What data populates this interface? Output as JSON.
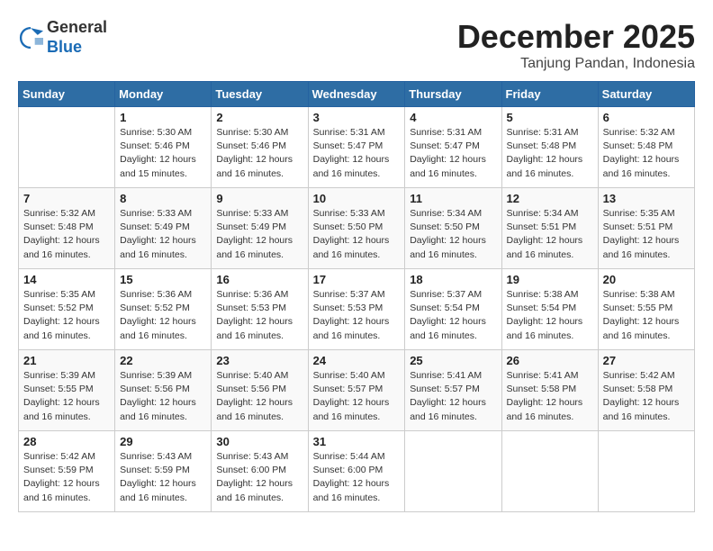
{
  "logo": {
    "general": "General",
    "blue": "Blue"
  },
  "title": "December 2025",
  "location": "Tanjung Pandan, Indonesia",
  "days_of_week": [
    "Sunday",
    "Monday",
    "Tuesday",
    "Wednesday",
    "Thursday",
    "Friday",
    "Saturday"
  ],
  "weeks": [
    [
      {
        "day": "",
        "info": ""
      },
      {
        "day": "1",
        "info": "Sunrise: 5:30 AM\nSunset: 5:46 PM\nDaylight: 12 hours\nand 15 minutes."
      },
      {
        "day": "2",
        "info": "Sunrise: 5:30 AM\nSunset: 5:46 PM\nDaylight: 12 hours\nand 16 minutes."
      },
      {
        "day": "3",
        "info": "Sunrise: 5:31 AM\nSunset: 5:47 PM\nDaylight: 12 hours\nand 16 minutes."
      },
      {
        "day": "4",
        "info": "Sunrise: 5:31 AM\nSunset: 5:47 PM\nDaylight: 12 hours\nand 16 minutes."
      },
      {
        "day": "5",
        "info": "Sunrise: 5:31 AM\nSunset: 5:48 PM\nDaylight: 12 hours\nand 16 minutes."
      },
      {
        "day": "6",
        "info": "Sunrise: 5:32 AM\nSunset: 5:48 PM\nDaylight: 12 hours\nand 16 minutes."
      }
    ],
    [
      {
        "day": "7",
        "info": "Sunrise: 5:32 AM\nSunset: 5:48 PM\nDaylight: 12 hours\nand 16 minutes."
      },
      {
        "day": "8",
        "info": "Sunrise: 5:33 AM\nSunset: 5:49 PM\nDaylight: 12 hours\nand 16 minutes."
      },
      {
        "day": "9",
        "info": "Sunrise: 5:33 AM\nSunset: 5:49 PM\nDaylight: 12 hours\nand 16 minutes."
      },
      {
        "day": "10",
        "info": "Sunrise: 5:33 AM\nSunset: 5:50 PM\nDaylight: 12 hours\nand 16 minutes."
      },
      {
        "day": "11",
        "info": "Sunrise: 5:34 AM\nSunset: 5:50 PM\nDaylight: 12 hours\nand 16 minutes."
      },
      {
        "day": "12",
        "info": "Sunrise: 5:34 AM\nSunset: 5:51 PM\nDaylight: 12 hours\nand 16 minutes."
      },
      {
        "day": "13",
        "info": "Sunrise: 5:35 AM\nSunset: 5:51 PM\nDaylight: 12 hours\nand 16 minutes."
      }
    ],
    [
      {
        "day": "14",
        "info": "Sunrise: 5:35 AM\nSunset: 5:52 PM\nDaylight: 12 hours\nand 16 minutes."
      },
      {
        "day": "15",
        "info": "Sunrise: 5:36 AM\nSunset: 5:52 PM\nDaylight: 12 hours\nand 16 minutes."
      },
      {
        "day": "16",
        "info": "Sunrise: 5:36 AM\nSunset: 5:53 PM\nDaylight: 12 hours\nand 16 minutes."
      },
      {
        "day": "17",
        "info": "Sunrise: 5:37 AM\nSunset: 5:53 PM\nDaylight: 12 hours\nand 16 minutes."
      },
      {
        "day": "18",
        "info": "Sunrise: 5:37 AM\nSunset: 5:54 PM\nDaylight: 12 hours\nand 16 minutes."
      },
      {
        "day": "19",
        "info": "Sunrise: 5:38 AM\nSunset: 5:54 PM\nDaylight: 12 hours\nand 16 minutes."
      },
      {
        "day": "20",
        "info": "Sunrise: 5:38 AM\nSunset: 5:55 PM\nDaylight: 12 hours\nand 16 minutes."
      }
    ],
    [
      {
        "day": "21",
        "info": "Sunrise: 5:39 AM\nSunset: 5:55 PM\nDaylight: 12 hours\nand 16 minutes."
      },
      {
        "day": "22",
        "info": "Sunrise: 5:39 AM\nSunset: 5:56 PM\nDaylight: 12 hours\nand 16 minutes."
      },
      {
        "day": "23",
        "info": "Sunrise: 5:40 AM\nSunset: 5:56 PM\nDaylight: 12 hours\nand 16 minutes."
      },
      {
        "day": "24",
        "info": "Sunrise: 5:40 AM\nSunset: 5:57 PM\nDaylight: 12 hours\nand 16 minutes."
      },
      {
        "day": "25",
        "info": "Sunrise: 5:41 AM\nSunset: 5:57 PM\nDaylight: 12 hours\nand 16 minutes."
      },
      {
        "day": "26",
        "info": "Sunrise: 5:41 AM\nSunset: 5:58 PM\nDaylight: 12 hours\nand 16 minutes."
      },
      {
        "day": "27",
        "info": "Sunrise: 5:42 AM\nSunset: 5:58 PM\nDaylight: 12 hours\nand 16 minutes."
      }
    ],
    [
      {
        "day": "28",
        "info": "Sunrise: 5:42 AM\nSunset: 5:59 PM\nDaylight: 12 hours\nand 16 minutes."
      },
      {
        "day": "29",
        "info": "Sunrise: 5:43 AM\nSunset: 5:59 PM\nDaylight: 12 hours\nand 16 minutes."
      },
      {
        "day": "30",
        "info": "Sunrise: 5:43 AM\nSunset: 6:00 PM\nDaylight: 12 hours\nand 16 minutes."
      },
      {
        "day": "31",
        "info": "Sunrise: 5:44 AM\nSunset: 6:00 PM\nDaylight: 12 hours\nand 16 minutes."
      },
      {
        "day": "",
        "info": ""
      },
      {
        "day": "",
        "info": ""
      },
      {
        "day": "",
        "info": ""
      }
    ]
  ]
}
